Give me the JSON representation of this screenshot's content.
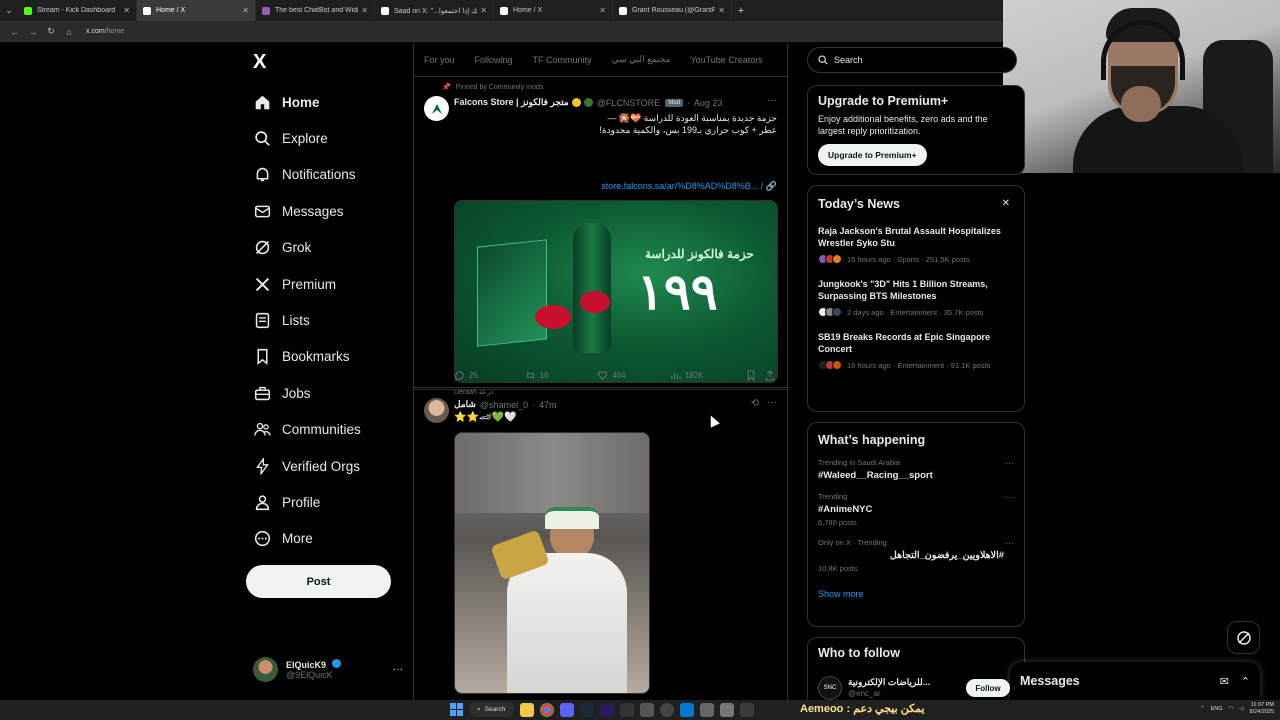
{
  "browser": {
    "tabs": [
      {
        "label": "Stream - Kick Dashboard",
        "favicon_color": "#53fc18",
        "active": false
      },
      {
        "label": "Home / X",
        "favicon_color": "#ffffff",
        "active": true
      },
      {
        "label": "The best ChatBot and Widgets",
        "favicon_color": "#9b59b6",
        "active": false
      },
      {
        "label": "Saad on X: \"...وكويك إذا اجتمعوا\"",
        "favicon_color": "#ffffff",
        "active": false
      },
      {
        "label": "Home / X",
        "favicon_color": "#ffffff",
        "active": false
      },
      {
        "label": "Grant Rousseau (@GrantRous)...",
        "favicon_color": "#ffffff",
        "active": false
      }
    ],
    "new_tab": "+",
    "url_host": "x.com",
    "url_path": "/home"
  },
  "sidebar": {
    "logo": "X",
    "items": [
      {
        "label": "Home",
        "icon": "home-icon"
      },
      {
        "label": "Explore",
        "icon": "search-icon"
      },
      {
        "label": "Notifications",
        "icon": "bell-icon"
      },
      {
        "label": "Messages",
        "icon": "mail-icon"
      },
      {
        "label": "Grok",
        "icon": "grok-icon"
      },
      {
        "label": "Premium",
        "icon": "x-logo-icon"
      },
      {
        "label": "Lists",
        "icon": "list-icon"
      },
      {
        "label": "Bookmarks",
        "icon": "bookmark-icon"
      },
      {
        "label": "Jobs",
        "icon": "briefcase-icon"
      },
      {
        "label": "Communities",
        "icon": "people-icon"
      },
      {
        "label": "Verified Orgs",
        "icon": "lightning-icon"
      },
      {
        "label": "Profile",
        "icon": "person-icon"
      },
      {
        "label": "More",
        "icon": "more-circle-icon"
      }
    ],
    "post_label": "Post",
    "account": {
      "name": "ElQuicK9",
      "handle": "@9ElQuicK",
      "more": "···"
    }
  },
  "feed": {
    "tabs": [
      "For you",
      "Following",
      "TF Community",
      "مجتمع البي سي",
      "YouTube Creators"
    ],
    "tweets": [
      {
        "pinned": "Pinned by Community mods",
        "name": "Falcons Store | متجر فالكونز",
        "handle": "@FLCNSTORE",
        "badge": "Mod",
        "time": "Aug 23",
        "line1": "حزمة جديدة بمناسبة العودة للدراسة 💝🎇 —",
        "line2": "عطر + كوب حراري بـ199 بس، والكمية محدودة!",
        "link": "store.falcons.sa/ar/%D8%AD%D8%B...",
        "media_text": "حزمة فالكونز للدراسة",
        "media_price": "١٩٩",
        "caption": "Deraah درعة",
        "replies": "25",
        "reposts": "16",
        "likes": "404",
        "views": "182K"
      },
      {
        "name": "شامل",
        "handle": "@shamel_0",
        "time": "47m",
        "text": "⭐⭐🏎💚🤍"
      }
    ]
  },
  "right": {
    "search_placeholder": "Search",
    "premium": {
      "title": "Upgrade to Premium+",
      "body": "Enjoy additional benefits, zero ads and the largest reply prioritization.",
      "button": "Upgrade to Premium+"
    },
    "news": {
      "title": "Today’s News",
      "close": "✕",
      "items": [
        {
          "title": "Raja Jackson's Brutal Assault Hospitalizes Wrestler Syko Stu",
          "meta": "15 hours ago · Sports · 251.5K posts"
        },
        {
          "title": "Jungkook's \"3D\" Hits 1 Billion Streams, Surpassing BTS Milestones",
          "meta": "2 days ago · Entertainment · 35.7K posts"
        },
        {
          "title": "SB19 Breaks Records at Epic Singapore Concert",
          "meta": "16 hours ago · Entertainment · 91.1K posts"
        }
      ]
    },
    "happening": {
      "title": "What’s happening",
      "trends": [
        {
          "context": "Trending in Saudi Arabia",
          "tag": "#Waleed__Racing__sport",
          "count": ""
        },
        {
          "context": "Trending",
          "tag": "#AnimeNYC",
          "count": "6,780 posts"
        },
        {
          "context": "Only on X · Trending",
          "tag": "#الاهلاويين_يرفضون_التجاهل",
          "count": "10.8K posts"
        }
      ],
      "show_more": "Show more"
    },
    "who_to_follow": {
      "title": "Who to follow",
      "name": "...للرياضات الإلكترونية",
      "handle": "@enc_ar",
      "button": "Follow"
    },
    "messages_drawer": "Messages"
  },
  "taskbar": {
    "search": "Search",
    "ticker": "Aemeoo : يمكن بيجي دعم",
    "lang": "ENG",
    "time": "11:07 PM",
    "date": "8/24/2025"
  },
  "colors": {
    "accent": "#1d9bf0",
    "border": "#2f3336",
    "muted": "#71767b"
  }
}
